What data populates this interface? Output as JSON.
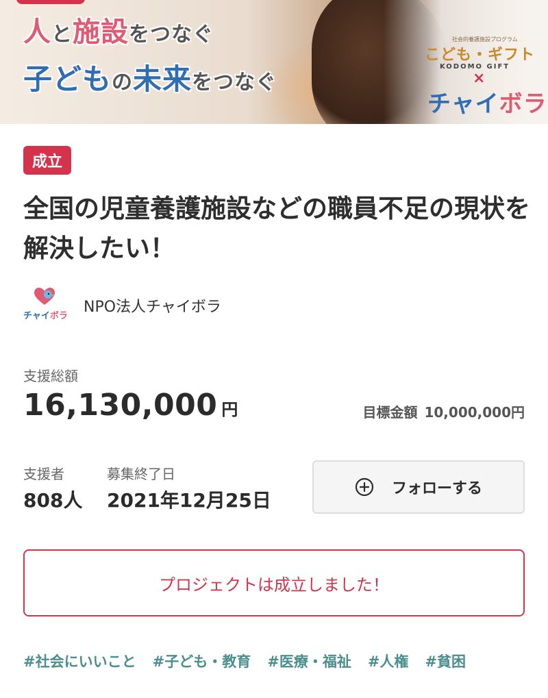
{
  "hero": {
    "line1_part1": "人",
    "line1_part2": "と",
    "line1_part3": "施設",
    "line1_part4": "をつなぐ",
    "line2_part1": "子ども",
    "line2_part2": "の",
    "line2_part3": "未来",
    "line2_part4": "をつなぐ",
    "logo_kicker": "社会的養護施設プログラム",
    "logo_kodomo": "こども・ギフト",
    "logo_kodomo_en": "KODOMO GIFT",
    "logo_x": "×",
    "logo_chaibora_1": "チャイ",
    "logo_chaibora_2": "ボラ"
  },
  "badge": {
    "label": "成立"
  },
  "project": {
    "title": "全国の児童養護施設などの職員不足の現状を解決したい！"
  },
  "organization": {
    "logo_text_1": "チャイ",
    "logo_text_2": "ボラ",
    "name": "NPO法人チャイボラ"
  },
  "funding": {
    "total_label": "支援総額",
    "total_value": "16,130,000",
    "currency_unit": "円",
    "goal_label": "目標金額",
    "goal_value": "10,000,000円"
  },
  "stats": {
    "supporters_label": "支援者",
    "supporters_value": "808人",
    "end_date_label": "募集終了日",
    "end_date_value": "2021年12月25日"
  },
  "follow_button": {
    "label": "フォローする",
    "icon": "plus-circle-icon"
  },
  "status_message": {
    "text": "プロジェクトは成立しました！"
  },
  "tags": [
    "#社会にいいこと",
    "#子ども・教育",
    "#医療・福祉",
    "#人権",
    "#貧困"
  ],
  "colors": {
    "accent_red": "#d4344b",
    "brand_pink": "#e05a73",
    "brand_blue": "#2f6db5",
    "tag_teal": "#4b8e8e"
  }
}
